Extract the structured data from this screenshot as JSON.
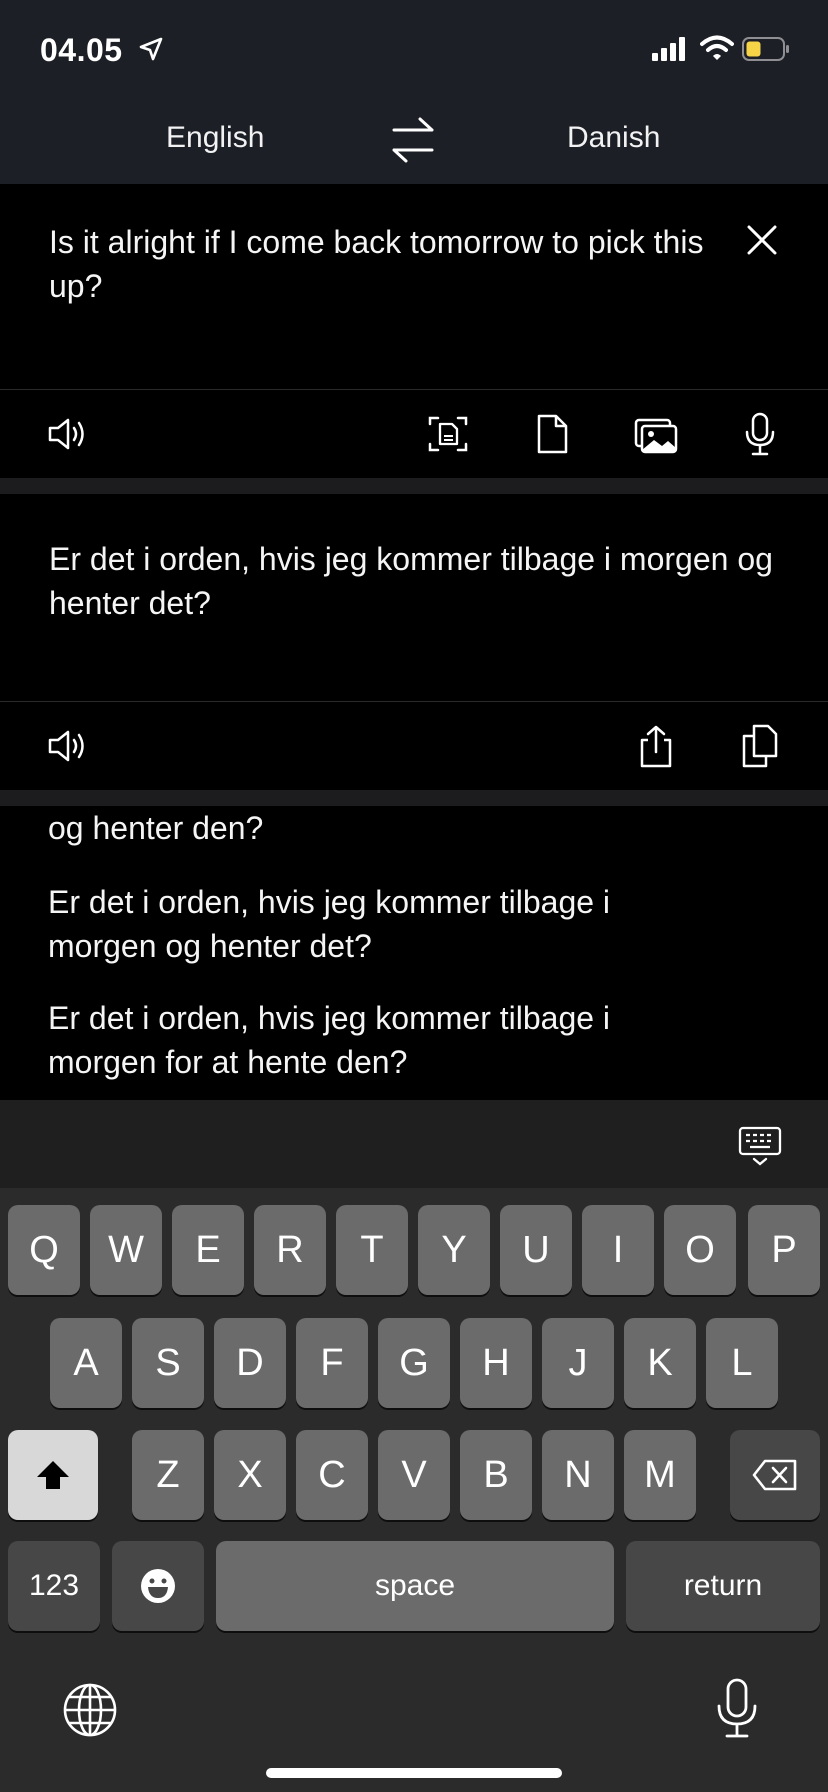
{
  "status_bar": {
    "time": "04.05",
    "icons": [
      "location-arrow-icon",
      "cellular-signal-icon",
      "wifi-icon",
      "battery-icon"
    ],
    "battery_color": "#f5d547"
  },
  "language_bar": {
    "source_language": "English",
    "target_language": "Danish",
    "swap_icon": "swap-arrows-icon"
  },
  "input": {
    "text": "Is it alright if I come back tomorrow to pick this up?",
    "clear_icon": "close-icon",
    "toolbar_icons": [
      "speaker-icon",
      "camera-text-icon",
      "document-icon",
      "photo-icon",
      "microphone-icon"
    ]
  },
  "output": {
    "text": "Er det i orden, hvis jeg kommer tilbage i morgen og henter det?",
    "toolbar_icons": [
      "speaker-icon",
      "share-icon",
      "copy-icon"
    ]
  },
  "alternatives": [
    "og henter den?",
    "Er det i orden, hvis jeg kommer tilbage i morgen og henter det?",
    "Er det i orden, hvis jeg kommer tilbage i morgen for at hente den?"
  ],
  "keyboard": {
    "row1": [
      "Q",
      "W",
      "E",
      "R",
      "T",
      "Y",
      "U",
      "I",
      "O",
      "P"
    ],
    "row2": [
      "A",
      "S",
      "D",
      "F",
      "G",
      "H",
      "J",
      "K",
      "L"
    ],
    "row3": [
      "Z",
      "X",
      "C",
      "V",
      "B",
      "N",
      "M"
    ],
    "numbers_label": "123",
    "space_label": "space",
    "return_label": "return",
    "icons": [
      "keyboard-hide-icon",
      "shift-icon",
      "backspace-icon",
      "emoji-icon",
      "globe-icon",
      "dictation-icon"
    ]
  }
}
